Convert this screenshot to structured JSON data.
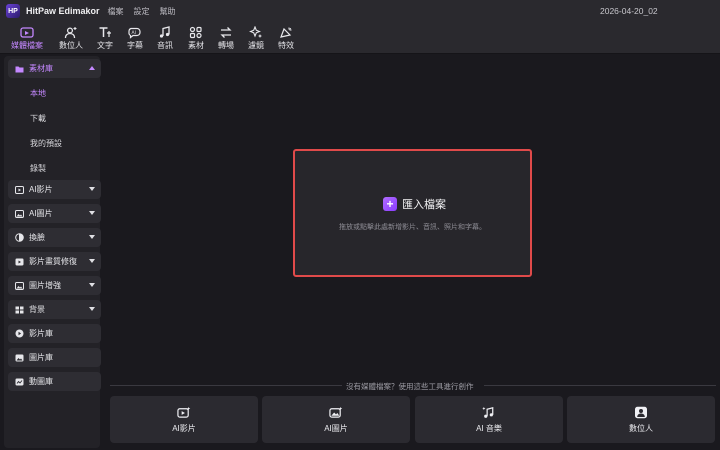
{
  "app": {
    "logo": "HP",
    "title": "HitPaw Edimakor",
    "project": "2026-04-20_02"
  },
  "menu": [
    "檔案",
    "設定",
    "幫助"
  ],
  "toolbar": [
    {
      "label": "媒體檔案",
      "icon": "media-icon",
      "active": true
    },
    {
      "label": "數位人",
      "icon": "avatar-icon"
    },
    {
      "label": "文字",
      "icon": "text-icon"
    },
    {
      "label": "字幕",
      "icon": "subtitle-icon"
    },
    {
      "label": "音訊",
      "icon": "music-icon"
    },
    {
      "label": "素材",
      "icon": "assets-icon"
    },
    {
      "label": "轉場",
      "icon": "transition-icon"
    },
    {
      "label": "濾鏡",
      "icon": "filter-icon"
    },
    {
      "label": "特效",
      "icon": "effects-icon"
    }
  ],
  "sidebar": {
    "library": {
      "label": "素材庫",
      "sub": [
        "本地",
        "下載",
        "我的預設",
        "錄製"
      ]
    },
    "sections": [
      "AI影片",
      "AI圖片",
      "換臉",
      "影片畫質修復",
      "圖片增強",
      "背景",
      "影片庫",
      "圖片庫",
      "動圖庫"
    ]
  },
  "dropzone": {
    "import_label": "匯入檔案",
    "hint": "拖放或點擊此處新增影片、音訊、照片和字幕。"
  },
  "quick": {
    "prompt": "沒有媒體檔案？使用這些工具進行創作",
    "cards": [
      "AI影片",
      "AI圖片",
      "AI 音樂",
      "數位人"
    ]
  }
}
